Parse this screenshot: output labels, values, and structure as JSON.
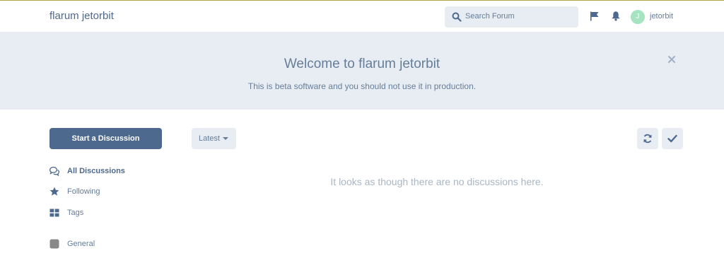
{
  "header": {
    "brand": "flarum jetorbit",
    "search_placeholder": "Search Forum",
    "user_initial": "J",
    "username": "jetorbit"
  },
  "hero": {
    "title": "Welcome to flarum jetorbit",
    "text": "This is beta software and you should not use it in production."
  },
  "toolbar": {
    "start_label": "Start a Discussion",
    "sort_label": "Latest"
  },
  "nav": {
    "items": [
      {
        "label": "All Discussions",
        "icon": "comments-icon",
        "active": true
      },
      {
        "label": "Following",
        "icon": "star-icon",
        "active": false
      },
      {
        "label": "Tags",
        "icon": "tags-grid-icon",
        "active": false
      },
      {
        "label": "General",
        "icon": "tag-square-icon",
        "active": false
      }
    ]
  },
  "discussions": {
    "empty_text": "It looks as though there are no discussions here."
  },
  "colors": {
    "primary": "#4d698e",
    "control_bg": "#e7edf3",
    "muted_text": "#667d99",
    "avatar": "#a6e3c0",
    "tag_general": "#888888",
    "top_accent": "#b8a640"
  }
}
